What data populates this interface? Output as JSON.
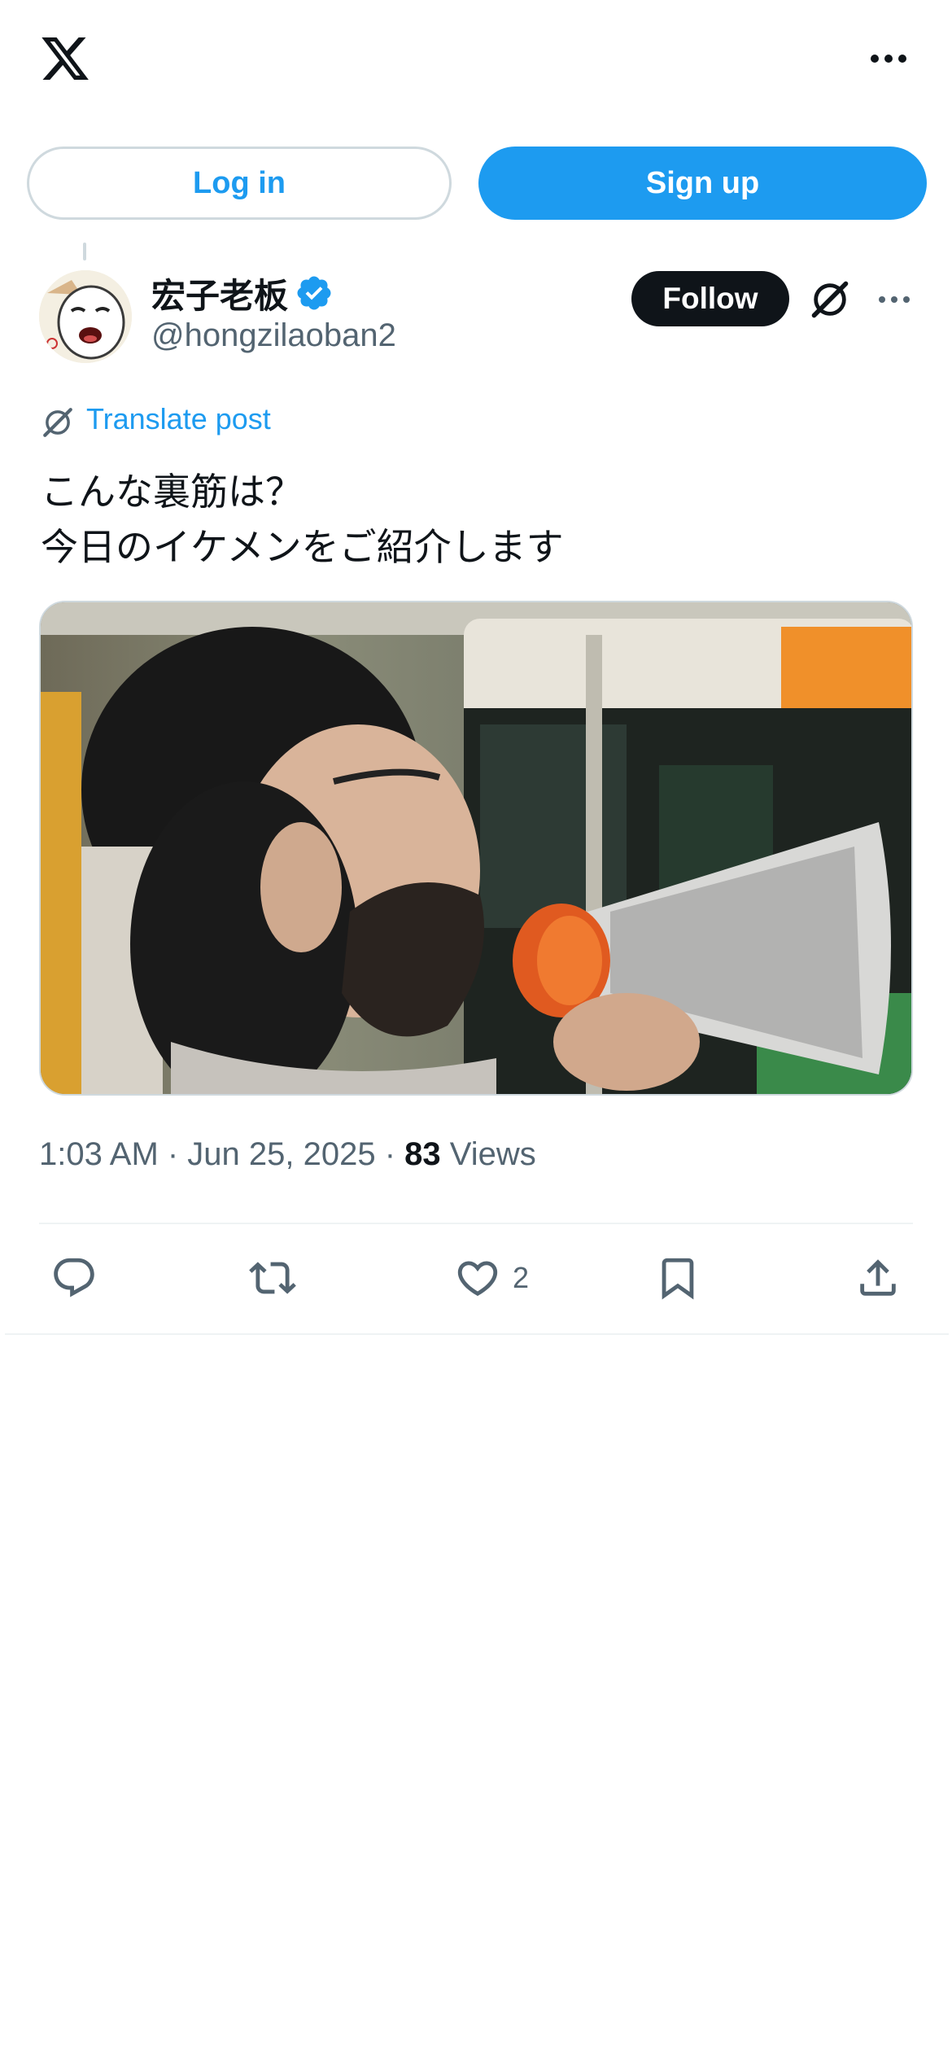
{
  "header": {
    "logo_icon": "x-logo-icon",
    "more_icon": "more-horizontal-icon"
  },
  "auth": {
    "login_label": "Log in",
    "signup_label": "Sign up"
  },
  "post": {
    "author": {
      "display_name": "宏子老板",
      "handle": "@hongzilaoban2",
      "verified": true
    },
    "follow_label": "Follow",
    "translate_label": "Translate post",
    "text_lines": [
      "こんな裏筋は？",
      "今日のイケメンをご紹介します"
    ],
    "timestamp": "1:03 AM · Jun 25, 2025 · ",
    "views_count": "83",
    "views_label": " Views",
    "actions": {
      "like_count": "2"
    }
  },
  "colors": {
    "accent": "#1d9bf0",
    "text_primary": "#0f1419",
    "text_secondary": "#536471",
    "border": "#cfd9de"
  }
}
